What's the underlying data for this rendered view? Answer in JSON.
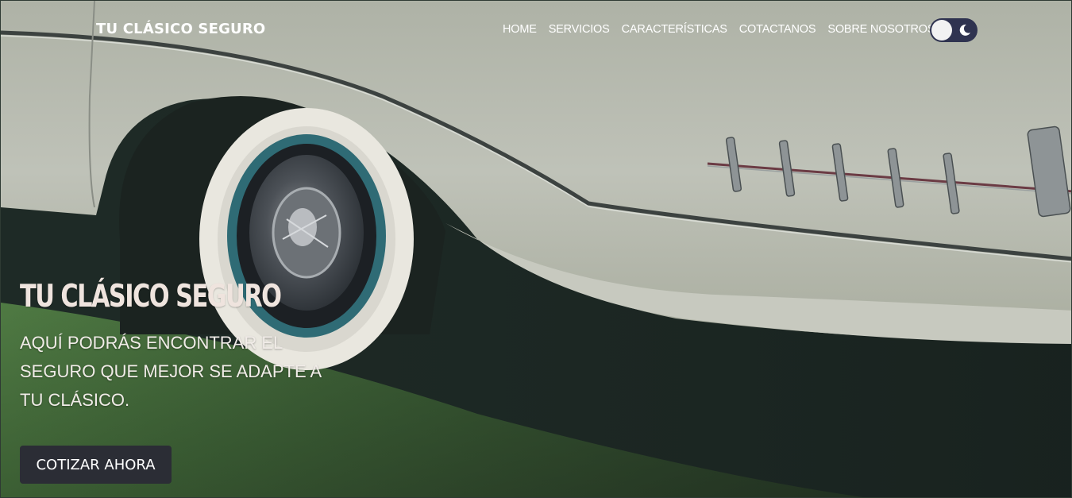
{
  "navbar": {
    "brand": "TU CLÁSICO SEGURO",
    "links": [
      {
        "label": "HOME"
      },
      {
        "label": "SERVICIOS"
      },
      {
        "label": "CARACTERÍSTICAS"
      },
      {
        "label": "COTACTANOS"
      },
      {
        "label": "SOBRE NOSOTROS"
      }
    ],
    "theme_toggle": {
      "state": "dark",
      "icon": "moon-icon"
    }
  },
  "hero": {
    "title": "TU CLÁSICO SEGURO",
    "subtitle": "AQUÍ PODRÁS ENCONTRAR EL SEGURO QUE MEJOR SE ADAPTE A TU CLÁSICO.",
    "cta_label": "COTIZAR AHORA",
    "background_image": "classic-car-wheel"
  },
  "colors": {
    "nav_text": "#ffffff",
    "cta_background": "#2b2d35",
    "toggle_background": "#2f3350",
    "hero_title": "#efe4de"
  }
}
